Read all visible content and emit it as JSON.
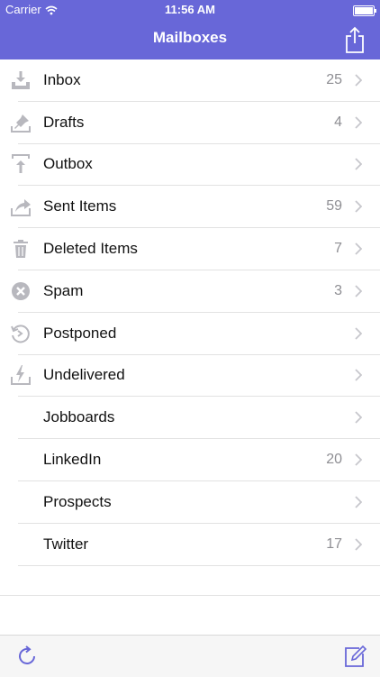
{
  "status": {
    "carrier": "Carrier",
    "time": "11:56 AM"
  },
  "header": {
    "title": "Mailboxes"
  },
  "colors": {
    "accent": "#6867d8",
    "icon_gray": "#b8b8be",
    "count_gray": "#8e8e93"
  },
  "mailboxes": [
    {
      "label": "Inbox",
      "count": "25",
      "icon": "inbox-download-icon"
    },
    {
      "label": "Drafts",
      "count": "4",
      "icon": "drafts-pin-icon"
    },
    {
      "label": "Outbox",
      "count": "",
      "icon": "outbox-upload-icon"
    },
    {
      "label": "Sent Items",
      "count": "59",
      "icon": "sent-arrow-icon"
    },
    {
      "label": "Deleted Items",
      "count": "7",
      "icon": "trash-icon"
    },
    {
      "label": "Spam",
      "count": "3",
      "icon": "spam-x-icon"
    },
    {
      "label": "Postponed",
      "count": "",
      "icon": "postponed-clock-icon"
    },
    {
      "label": "Undelivered",
      "count": "",
      "icon": "undelivered-bolt-icon"
    },
    {
      "label": "Jobboards",
      "count": "",
      "icon": ""
    },
    {
      "label": "LinkedIn",
      "count": "20",
      "icon": ""
    },
    {
      "label": "Prospects",
      "count": "",
      "icon": ""
    },
    {
      "label": "Twitter",
      "count": "17",
      "icon": ""
    }
  ],
  "toolbar": {
    "refresh_icon": "refresh-icon",
    "compose_icon": "compose-icon"
  }
}
